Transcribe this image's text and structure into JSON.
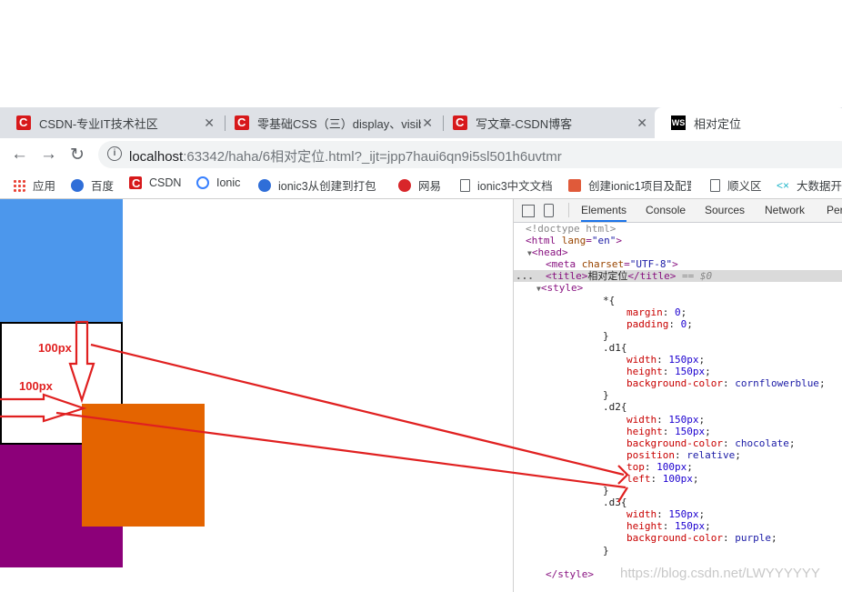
{
  "tabs": [
    {
      "title": "CSDN-专业IT技术社区",
      "active": false
    },
    {
      "title": "零基础CSS（三）display、visibi",
      "active": false
    },
    {
      "title": "写文章-CSDN博客",
      "active": false
    },
    {
      "title": "相对定位",
      "active": true
    }
  ],
  "tab_close": "✕",
  "ws_favicon": "WS",
  "nav": {
    "back": "←",
    "forward": "→",
    "reload": "↻"
  },
  "url": {
    "host": "localhost",
    "rest": ":63342/haha/6相对定位.html?_ijt=jpp7haui6qn9i5sl501h6uvtmr",
    "info": "i"
  },
  "bookmarks": [
    "应用",
    "百度",
    "CSDN",
    "Ionic",
    "ionic3从创建到打包",
    "网易",
    "ionic3中文文档",
    "创建ionic1项目及配置",
    "顺义区",
    "大数据开"
  ],
  "devtools": {
    "tabs": [
      "Elements",
      "Console",
      "Sources",
      "Network",
      "Per"
    ],
    "selected_tab": "Elements"
  },
  "code": {
    "doctype": "<!doctype html>",
    "html_open": "html",
    "lang_attr": "lang",
    "lang_val": "\"en\"",
    "head": "head",
    "meta": "meta",
    "charset_attr": "charset",
    "charset_val": "\"UTF-8\"",
    "title_tag": "title",
    "title_text": "相对定位",
    "sel_marker": "== $0",
    "ellipsis": "...",
    "style_tag": "style",
    "style_close": "</style>"
  },
  "css_rules": [
    {
      "sel": "*{",
      "decls": [
        [
          "margin",
          "0"
        ],
        [
          "padding",
          "0"
        ]
      ]
    },
    {
      "sel": ".d1{",
      "decls": [
        [
          "width",
          "150px"
        ],
        [
          "height",
          "150px"
        ],
        [
          "background-color",
          "cornflowerblue"
        ]
      ]
    },
    {
      "sel": ".d2{",
      "decls": [
        [
          "width",
          "150px"
        ],
        [
          "height",
          "150px"
        ],
        [
          "background-color",
          "chocolate"
        ],
        [
          "position",
          "relative"
        ],
        [
          "top",
          "100px"
        ],
        [
          "left",
          "100px"
        ]
      ]
    },
    {
      "sel": ".d3{",
      "decls": [
        [
          "width",
          "150px"
        ],
        [
          "height",
          "150px"
        ],
        [
          "background-color",
          "purple"
        ]
      ]
    }
  ],
  "annotations": {
    "label_top": "100px",
    "label_left": "100px"
  },
  "watermark": "https://blog.csdn.net/LWYYYYYY",
  "colors": {
    "d1": "#4c97ec",
    "d2": "#e46400",
    "d3": "#8c0079",
    "annotation": "#e02020"
  }
}
